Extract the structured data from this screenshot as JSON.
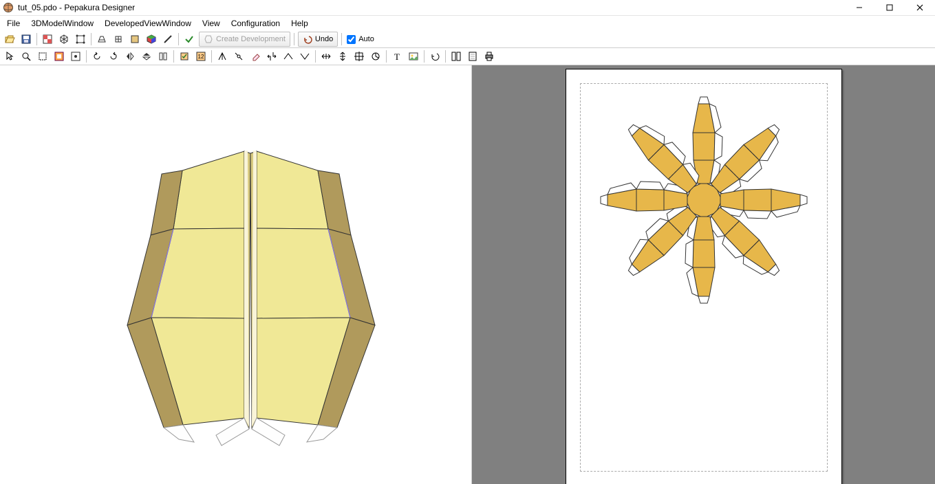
{
  "title": "tut_05.pdo - Pepakura Designer",
  "menu": {
    "file": "File",
    "m3d": "3DModelWindow",
    "dev": "DevelopedViewWindow",
    "view": "View",
    "config": "Configuration",
    "help": "Help"
  },
  "toolbar": {
    "create_dev": "Create Development",
    "undo": "Undo",
    "auto": "Auto"
  },
  "colors": {
    "model_light": "#f0e896",
    "model_mid": "#d8c97e",
    "model_dark": "#b09a5c",
    "unfold": "#e7b74a"
  }
}
